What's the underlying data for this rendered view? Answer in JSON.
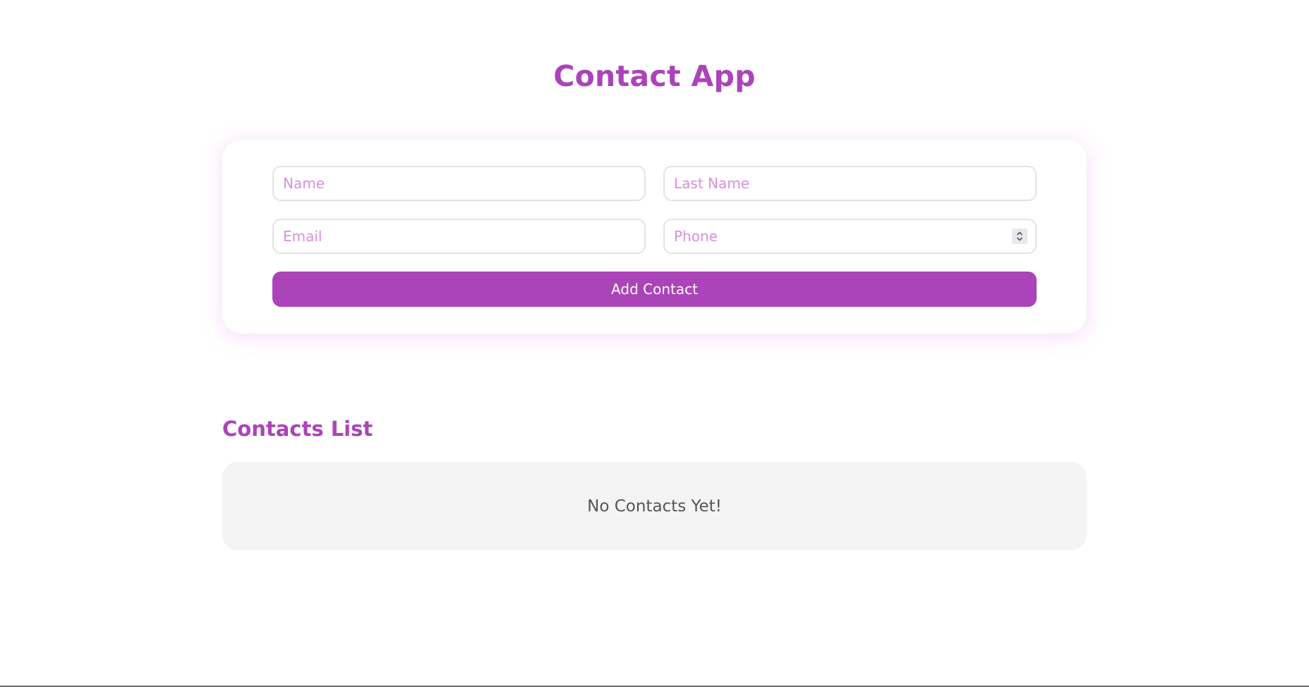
{
  "header": {
    "title": "Contact App"
  },
  "form": {
    "name_placeholder": "Name",
    "last_name_placeholder": "Last Name",
    "email_placeholder": "Email",
    "phone_placeholder": "Phone",
    "submit_label": "Add Contact"
  },
  "contacts": {
    "title": "Contacts List",
    "empty_message": "No Contacts Yet!"
  },
  "colors": {
    "accent": "#ab43b9",
    "placeholder": "#d98ee0",
    "empty_background": "#f4f4f4"
  },
  "icons": {
    "phone_stepper": "chevron-up-down-icon"
  }
}
